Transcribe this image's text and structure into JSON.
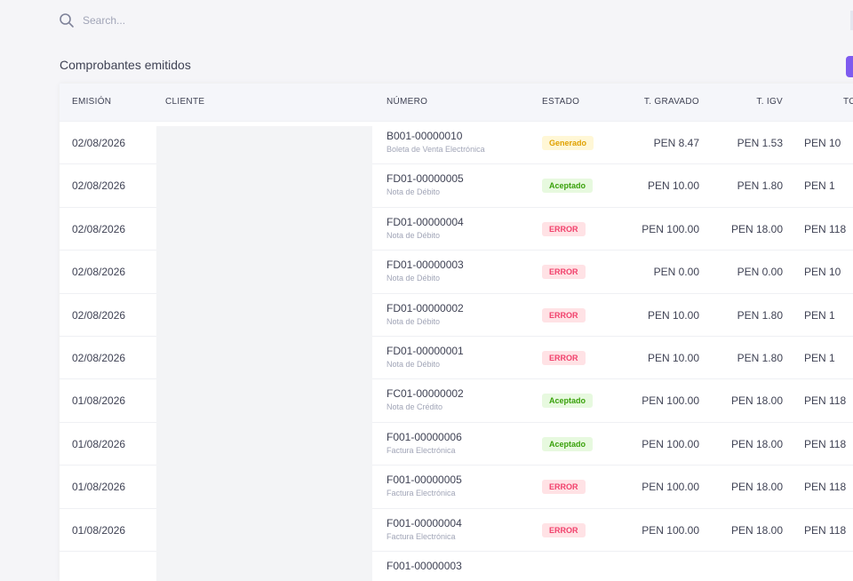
{
  "search": {
    "placeholder": "Search..."
  },
  "page": {
    "title": "Comprobantes emitidos"
  },
  "colors": {
    "accent": "#7e5bef",
    "generado": "#e0a100",
    "aceptado": "#3aa10c",
    "error": "#f1416c"
  },
  "table": {
    "columns": {
      "emision": "EMISIÓN",
      "cliente": "CLIENTE",
      "numero": "NÚMERO",
      "estado": "ESTADO",
      "gravado": "T. GRAVADO",
      "igv": "T. IGV",
      "total": "TO"
    },
    "rows": [
      {
        "emision": "02/08/2026",
        "numero": "B001-00000010",
        "tipo": "Boleta de Venta Electrónica",
        "estado": "Generado",
        "estado_kind": "gen",
        "gravado": "PEN 8.47",
        "igv": "PEN 1.53",
        "total": "PEN 10"
      },
      {
        "emision": "02/08/2026",
        "numero": "FD01-00000005",
        "tipo": "Nota de Débito",
        "estado": "Aceptado",
        "estado_kind": "ok",
        "gravado": "PEN 10.00",
        "igv": "PEN 1.80",
        "total": "PEN 1"
      },
      {
        "emision": "02/08/2026",
        "numero": "FD01-00000004",
        "tipo": "Nota de Débito",
        "estado": "ERROR",
        "estado_kind": "err",
        "gravado": "PEN 100.00",
        "igv": "PEN 18.00",
        "total": "PEN 118"
      },
      {
        "emision": "02/08/2026",
        "numero": "FD01-00000003",
        "tipo": "Nota de Débito",
        "estado": "ERROR",
        "estado_kind": "err",
        "gravado": "PEN 0.00",
        "igv": "PEN 0.00",
        "total": "PEN 10"
      },
      {
        "emision": "02/08/2026",
        "numero": "FD01-00000002",
        "tipo": "Nota de Débito",
        "estado": "ERROR",
        "estado_kind": "err",
        "gravado": "PEN 10.00",
        "igv": "PEN 1.80",
        "total": "PEN 1"
      },
      {
        "emision": "02/08/2026",
        "numero": "FD01-00000001",
        "tipo": "Nota de Débito",
        "estado": "ERROR",
        "estado_kind": "err",
        "gravado": "PEN 10.00",
        "igv": "PEN 1.80",
        "total": "PEN 1"
      },
      {
        "emision": "01/08/2026",
        "numero": "FC01-00000002",
        "tipo": "Nota de Crédito",
        "estado": "Aceptado",
        "estado_kind": "ok",
        "gravado": "PEN 100.00",
        "igv": "PEN 18.00",
        "total": "PEN 118"
      },
      {
        "emision": "01/08/2026",
        "numero": "F001-00000006",
        "tipo": "Factura Electrónica",
        "estado": "Aceptado",
        "estado_kind": "ok",
        "gravado": "PEN 100.00",
        "igv": "PEN 18.00",
        "total": "PEN 118"
      },
      {
        "emision": "01/08/2026",
        "numero": "F001-00000005",
        "tipo": "Factura Electrónica",
        "estado": "ERROR",
        "estado_kind": "err",
        "gravado": "PEN 100.00",
        "igv": "PEN 18.00",
        "total": "PEN 118"
      },
      {
        "emision": "01/08/2026",
        "numero": "F001-00000004",
        "tipo": "Factura Electrónica",
        "estado": "ERROR",
        "estado_kind": "err",
        "gravado": "PEN 100.00",
        "igv": "PEN 18.00",
        "total": "PEN 118"
      },
      {
        "emision": "",
        "numero": "F001-00000003",
        "tipo": "",
        "estado": "",
        "estado_kind": "err",
        "gravado": "",
        "igv": "",
        "total": ""
      }
    ]
  }
}
